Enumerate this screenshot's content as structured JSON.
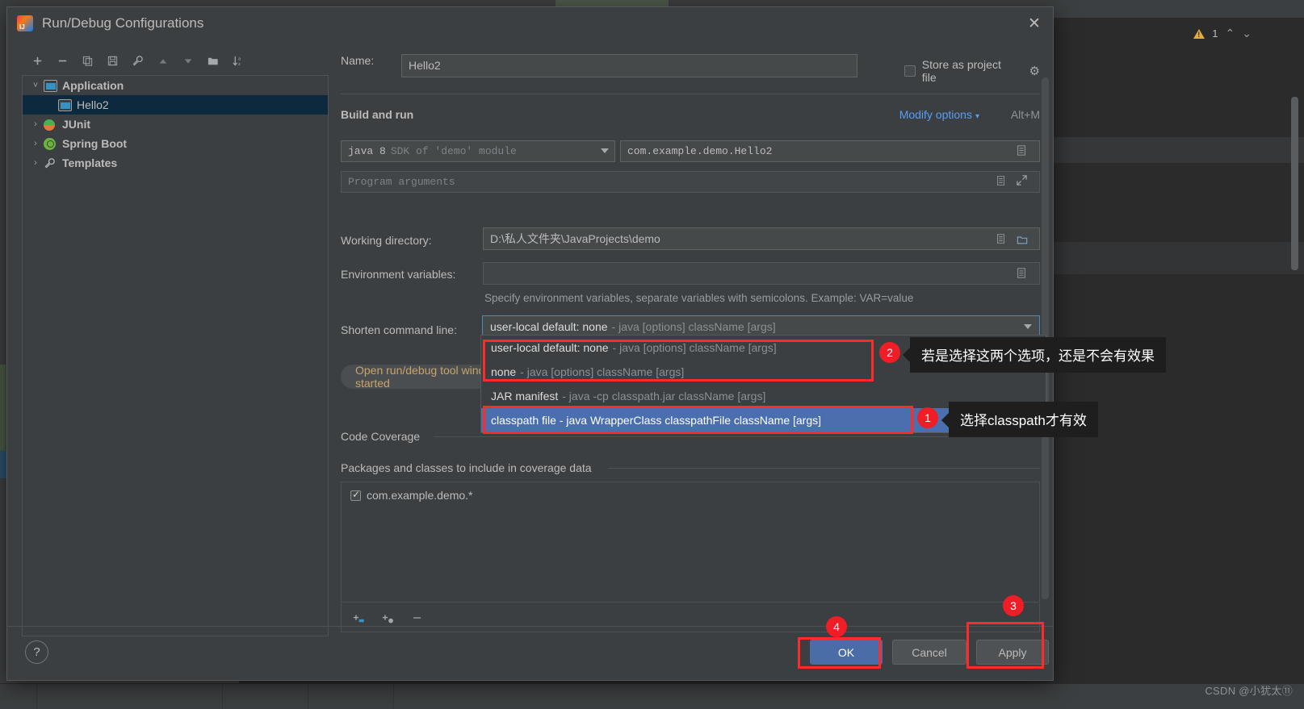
{
  "ide": {
    "inspection_count": "1",
    "warning_icon": "warning-triangle-icon",
    "up_icon": "chevron-up-icon",
    "down_icon": "chevron-down-icon",
    "watermark": "CSDN @小犹太⑪"
  },
  "dialog": {
    "title": "Run/Debug Configurations",
    "logo": "intellij-idea-logo",
    "close_icon": "✕"
  },
  "toolbar": {
    "buttons": [
      {
        "name": "add-configuration-button",
        "glyph": "＋"
      },
      {
        "name": "remove-configuration-button",
        "glyph": "－"
      },
      {
        "name": "copy-configuration-button",
        "glyph": "❐"
      },
      {
        "name": "save-configuration-button",
        "glyph": "🖫"
      },
      {
        "name": "edit-templates-button",
        "glyph": "🔧"
      },
      {
        "name": "move-up-button",
        "glyph": "▲"
      },
      {
        "name": "move-down-button",
        "glyph": "▼"
      },
      {
        "name": "new-folder-button",
        "glyph": "🗀"
      },
      {
        "name": "sort-configurations-button",
        "glyph": "↓ᵃz"
      }
    ]
  },
  "tree": {
    "items": [
      {
        "label": "Application",
        "expander": "˅",
        "icon": "application-icon",
        "selected": false,
        "child": false
      },
      {
        "label": "Hello2",
        "expander": "",
        "icon": "application-icon",
        "selected": true,
        "child": true
      },
      {
        "label": "JUnit",
        "expander": "›",
        "icon": "junit-icon",
        "selected": false,
        "child": false
      },
      {
        "label": "Spring Boot",
        "expander": "›",
        "icon": "spring-boot-icon",
        "selected": false,
        "child": false
      },
      {
        "label": "Templates",
        "expander": "›",
        "icon": "wrench-icon",
        "selected": false,
        "child": false
      }
    ]
  },
  "form": {
    "name_label": "Name:",
    "name_value": "Hello2",
    "store_as_project_file": "Store as project file",
    "store_gear_icon": "gear-icon",
    "build_and_run": "Build and run",
    "modify_options": "Modify options",
    "modify_shortcut": "Alt+M",
    "sdk_primary": "java 8",
    "sdk_secondary": "SDK of 'demo' module",
    "main_class": "com.example.demo.Hello2",
    "program_arguments_placeholder": "Program arguments",
    "working_directory_label": "Working directory:",
    "working_directory_value": "D:\\私人文件夹\\JavaProjects\\demo",
    "environment_variables_label": "Environment variables:",
    "environment_variables_value": "",
    "environment_hint": "Specify environment variables, separate variables with semicolons. Example: VAR=value",
    "shorten_command_line_label": "Shorten command line:",
    "shorten_command_line_bold": "user-local default: none",
    "shorten_command_line_desc": "- java [options] className [args]",
    "open_tool_window_button": "Open run/debug tool window when started",
    "code_coverage_title": "Code Coverage",
    "packages_title": "Packages and classes to include in coverage data",
    "coverage_items": [
      {
        "label": "com.example.demo.*",
        "checked": true
      }
    ],
    "coverage_toolbar": [
      {
        "name": "add-package-button",
        "glyph": "＋"
      },
      {
        "name": "add-class-button",
        "glyph": "＋"
      },
      {
        "name": "remove-pattern-button",
        "glyph": "－"
      }
    ]
  },
  "dropdown": {
    "options": [
      {
        "bold": "user-local default: none",
        "desc": "- java [options] className [args]",
        "selected": false
      },
      {
        "bold": "none",
        "desc": "- java [options] className [args]",
        "selected": false
      },
      {
        "bold": "JAR manifest",
        "desc": "- java -cp classpath.jar className [args]",
        "selected": false
      },
      {
        "bold": "classpath file - java WrapperClass classpathFile className [args]",
        "desc": "",
        "selected": true
      }
    ]
  },
  "annotations": [
    {
      "badge": "1",
      "text": "选择classpath才有效"
    },
    {
      "badge": "2",
      "text": "若是选择这两个选项，还是不会有效果"
    },
    {
      "badge": "3",
      "text": ""
    },
    {
      "badge": "4",
      "text": ""
    }
  ],
  "buttons": {
    "help": "?",
    "ok": "OK",
    "cancel": "Cancel",
    "apply": "Apply"
  },
  "colors": {
    "accent_blue": "#4b6eaf",
    "link_blue": "#589df6",
    "annotation_red": "#ee1d26",
    "dialog_bg": "#3c3f41",
    "field_bg": "#45494a",
    "selection_navy": "#0d293e"
  }
}
